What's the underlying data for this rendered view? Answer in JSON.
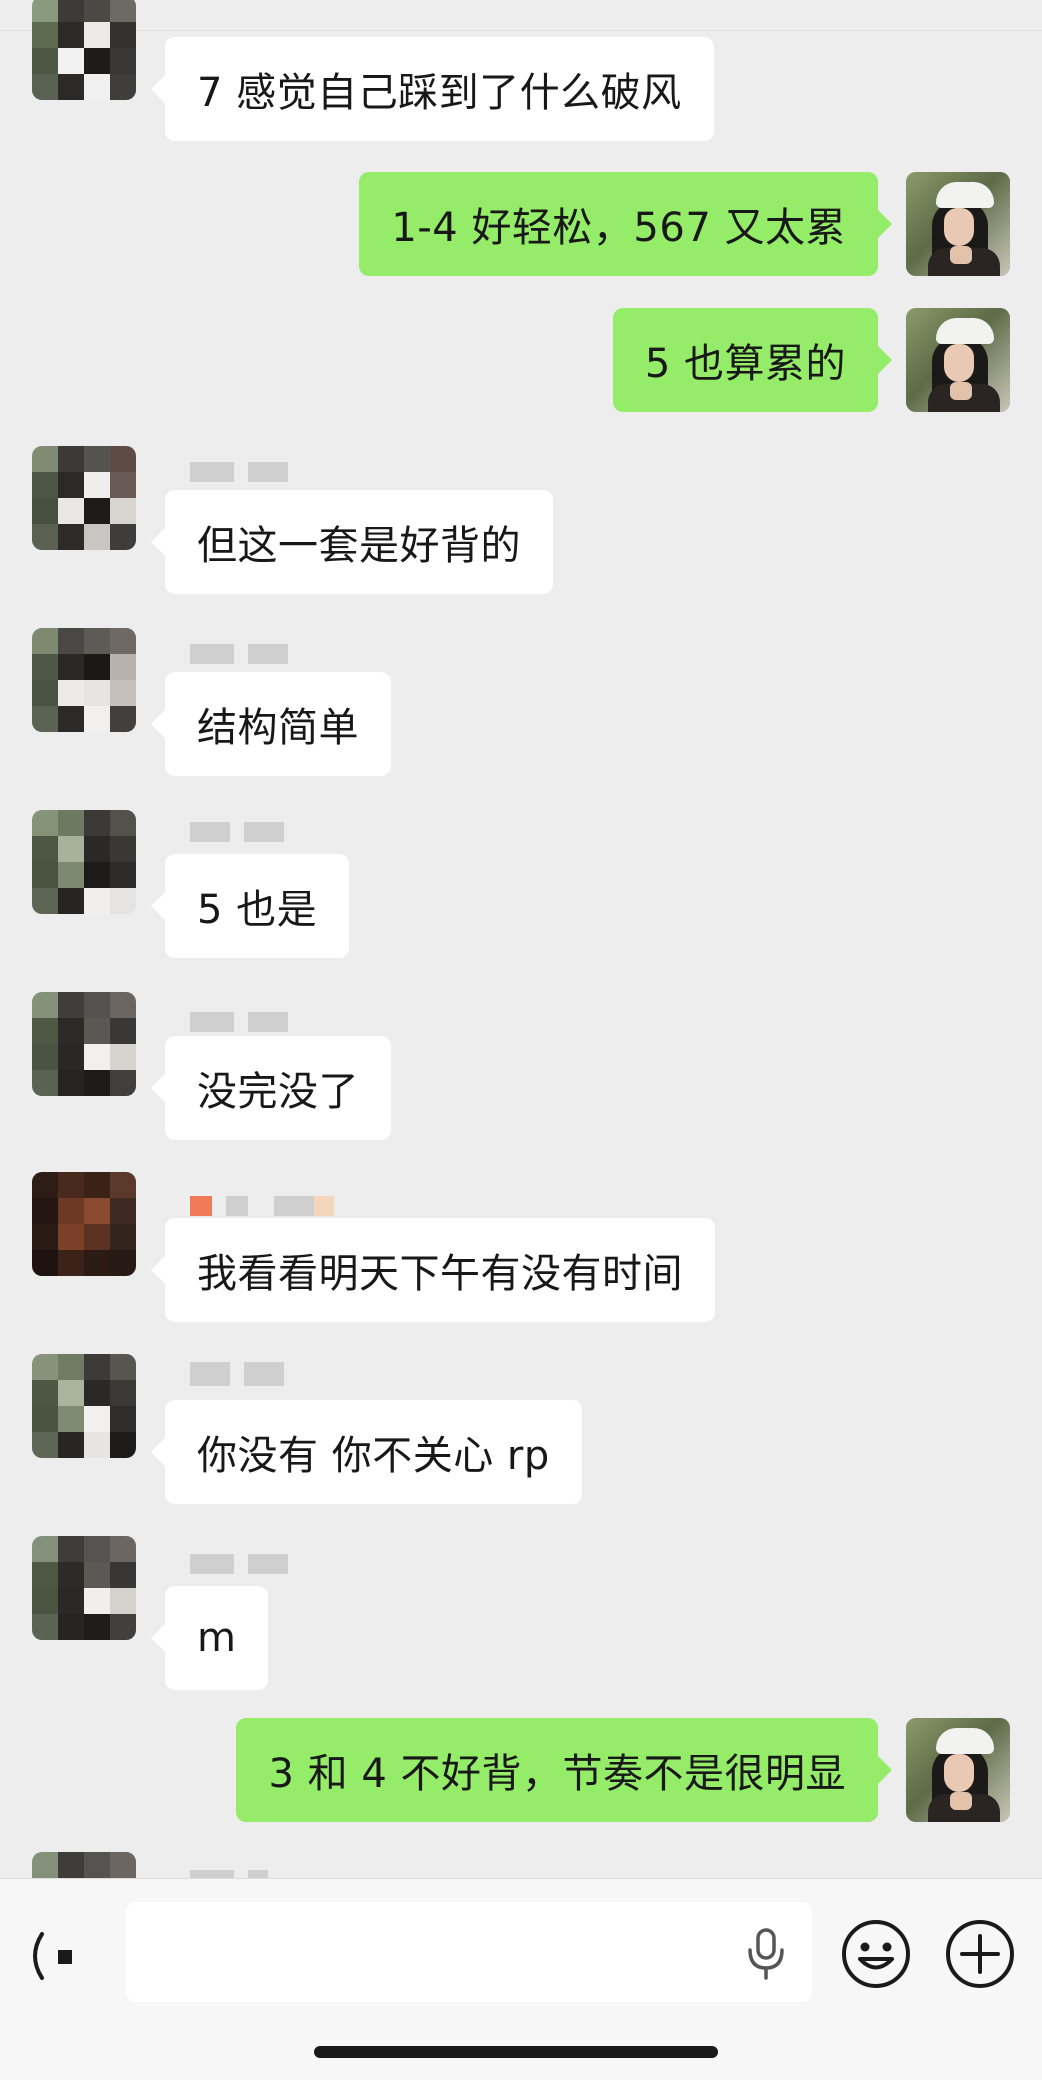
{
  "messages": [
    {
      "side": "in",
      "text": "7 感觉自己踩到了什么破风"
    },
    {
      "side": "out",
      "text": "1-4 好轻松，567 又太累"
    },
    {
      "side": "out",
      "text": "5 也算累的"
    },
    {
      "side": "in",
      "text": "但这一套是好背的"
    },
    {
      "side": "in",
      "text": "结构简单"
    },
    {
      "side": "in",
      "text": "5 也是"
    },
    {
      "side": "in",
      "text": "没完没了"
    },
    {
      "side": "in",
      "text": "我看看明天下午有没有时间"
    },
    {
      "side": "in",
      "text": "你没有 你不关心 rp"
    },
    {
      "side": "in",
      "text": "m"
    },
    {
      "side": "out",
      "text": "3 和 4 不好背，节奏不是很明显"
    }
  ],
  "colors": {
    "background": "#ededed",
    "incoming_bubble": "#ffffff",
    "outgoing_bubble": "#95ec69",
    "text": "#181818"
  },
  "input_bar": {
    "icons": [
      "voice-icon",
      "microphone-icon",
      "emoji-icon",
      "plus-icon"
    ]
  }
}
